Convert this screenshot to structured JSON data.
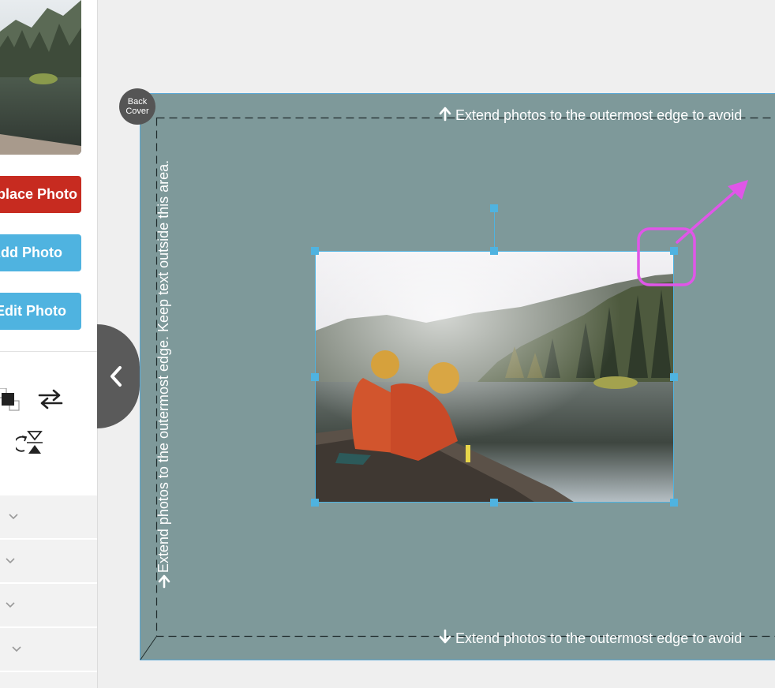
{
  "sidebar": {
    "buttons": {
      "replace_label": "Replace Photo",
      "add_label": "Add Photo",
      "edit_label": "Edit Photo"
    }
  },
  "canvas": {
    "badge_line1": "Back",
    "badge_line2": "Cover",
    "top_notice": "Extend photos to the outermost edge to avoid",
    "bottom_notice": "Extend photos to the outermost edge to avoid",
    "side_notice": "Extend photos to the outermost edge. Keep text outside this area."
  },
  "colors": {
    "cover_background": "#7e999a",
    "selection_blue": "#4fb3e0",
    "primary_red": "#c72b20",
    "annotation_magenta": "#e056e8"
  }
}
